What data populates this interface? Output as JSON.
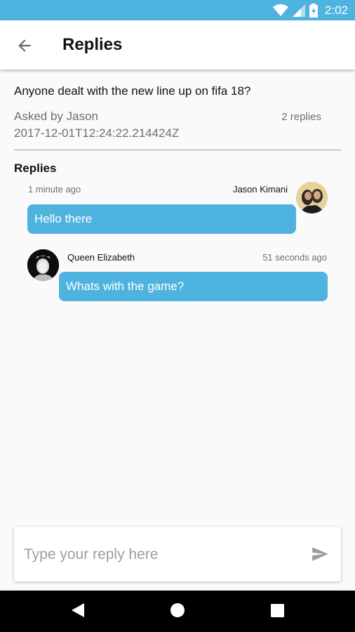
{
  "status_bar": {
    "time": "2:02",
    "icons": [
      "wifi-icon",
      "signal-icon",
      "battery-icon"
    ],
    "color": "#4fb3e0"
  },
  "app_bar": {
    "title": "Replies",
    "back_icon": "arrow-left-icon"
  },
  "question": {
    "text": "Anyone dealt with the new line up on fifa 18?",
    "asked_by": "Asked by Jason",
    "reply_count": "2 replies",
    "datetime": "2017-12-01T12:24:22.214424Z"
  },
  "replies_section": {
    "title": "Replies",
    "items": [
      {
        "time": "1 minute ago",
        "author": "Jason Kimani",
        "message": "Hello there",
        "side": "right"
      },
      {
        "time": "51 seconds ago",
        "author": "Queen Elizabeth",
        "message": "Whats with the game?",
        "side": "left"
      }
    ]
  },
  "composer": {
    "placeholder": "Type your reply here",
    "send_icon": "send-icon"
  },
  "nav_bar": {
    "icons": [
      "back-triangle-icon",
      "home-circle-icon",
      "recents-square-icon"
    ]
  },
  "colors": {
    "accent": "#4fb3e0",
    "background": "#fafafa",
    "secondary_text": "#6e6e6e"
  }
}
